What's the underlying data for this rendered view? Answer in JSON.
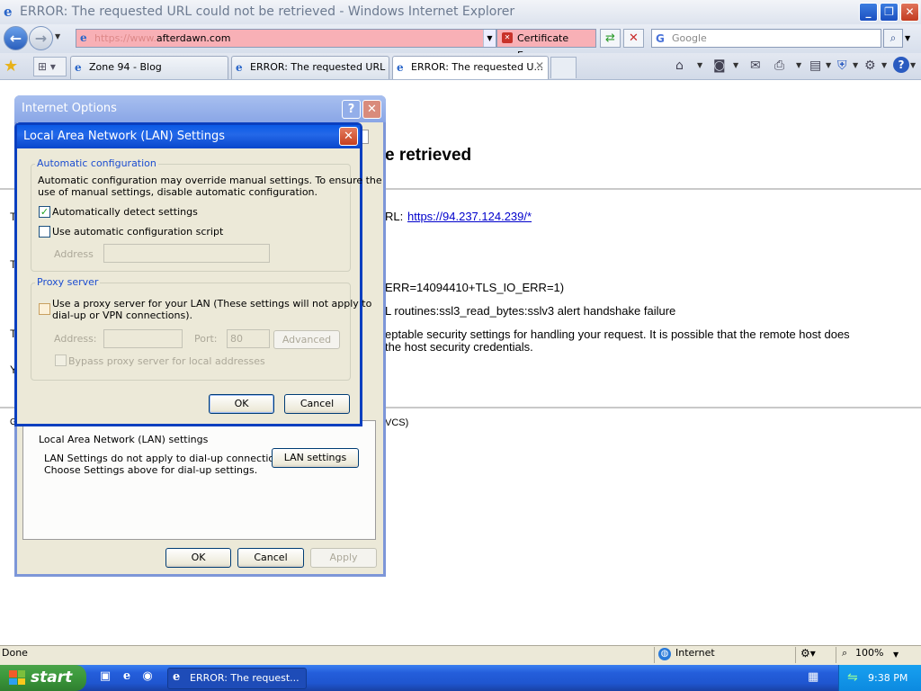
{
  "ie": {
    "title": "ERROR: The requested URL could not be retrieved - Windows Internet Explorer",
    "address_prefix": "https://www.",
    "address_domain": "afterdawn.com",
    "cert_error": "Certificate Error",
    "search_placeholder": "Google",
    "tabs": [
      {
        "label": "Zone 94 - Blog"
      },
      {
        "label": "ERROR: The requested URL ..."
      },
      {
        "label": "ERROR: The requested U..."
      }
    ]
  },
  "page": {
    "heading": "e retrieved",
    "url_label": "RL:",
    "url_link": "https://94.237.124.239/*",
    "err_code": "ERR=14094410+TLS_IO_ERR=1)",
    "ssl_line": "L routines:ssl3_read_bytes:sslv3 alert handshake failure",
    "security_line1": "eptable security settings for handling your request. It is possible that the remote host does",
    "security_line2": " the host security credentials.",
    "footer_text": "VCS)",
    "left_chars": [
      "T",
      "T",
      "T",
      "Y",
      "G"
    ]
  },
  "internet_options": {
    "title": "Internet Options",
    "help_glyph": "?",
    "lan_section_label": "Local Area Network (LAN) settings",
    "lan_note_line1": "LAN Settings do not apply to dial-up connections.",
    "lan_note_line2": "Choose Settings above for dial-up settings.",
    "lan_settings_button": "LAN settings",
    "ok": "OK",
    "cancel": "Cancel",
    "apply": "Apply"
  },
  "lan_dialog": {
    "title": "Local Area Network (LAN) Settings",
    "auto_config_legend": "Automatic configuration",
    "auto_config_desc_line1": "Automatic configuration may override manual settings.  To ensure the",
    "auto_config_desc_line2": "use of manual settings, disable automatic configuration.",
    "auto_detect_label": "Automatically detect settings",
    "auto_detect_checked": true,
    "use_script_label": "Use automatic configuration script",
    "use_script_checked": false,
    "address_label": "Address",
    "address_value": "",
    "proxy_legend": "Proxy server",
    "use_proxy_line1": "Use a proxy server for your LAN (These settings will not apply to",
    "use_proxy_line2": "dial-up or VPN connections).",
    "use_proxy_checked": false,
    "proxy_address_label": "Address:",
    "proxy_address_value": "",
    "port_label": "Port:",
    "port_value": "80",
    "advanced_button": "Advanced",
    "bypass_label": "Bypass proxy server for local addresses",
    "ok": "OK",
    "cancel": "Cancel"
  },
  "status": {
    "text": "Done",
    "zone": "Internet",
    "zoom": "100%"
  },
  "taskbar": {
    "start": "start",
    "task": "ERROR: The request...",
    "clock": "9:38 PM"
  },
  "colors": {
    "address_error_bg": "#f8b0b6",
    "xp_blue": "#0a3fbf",
    "link": "#0000cc"
  }
}
